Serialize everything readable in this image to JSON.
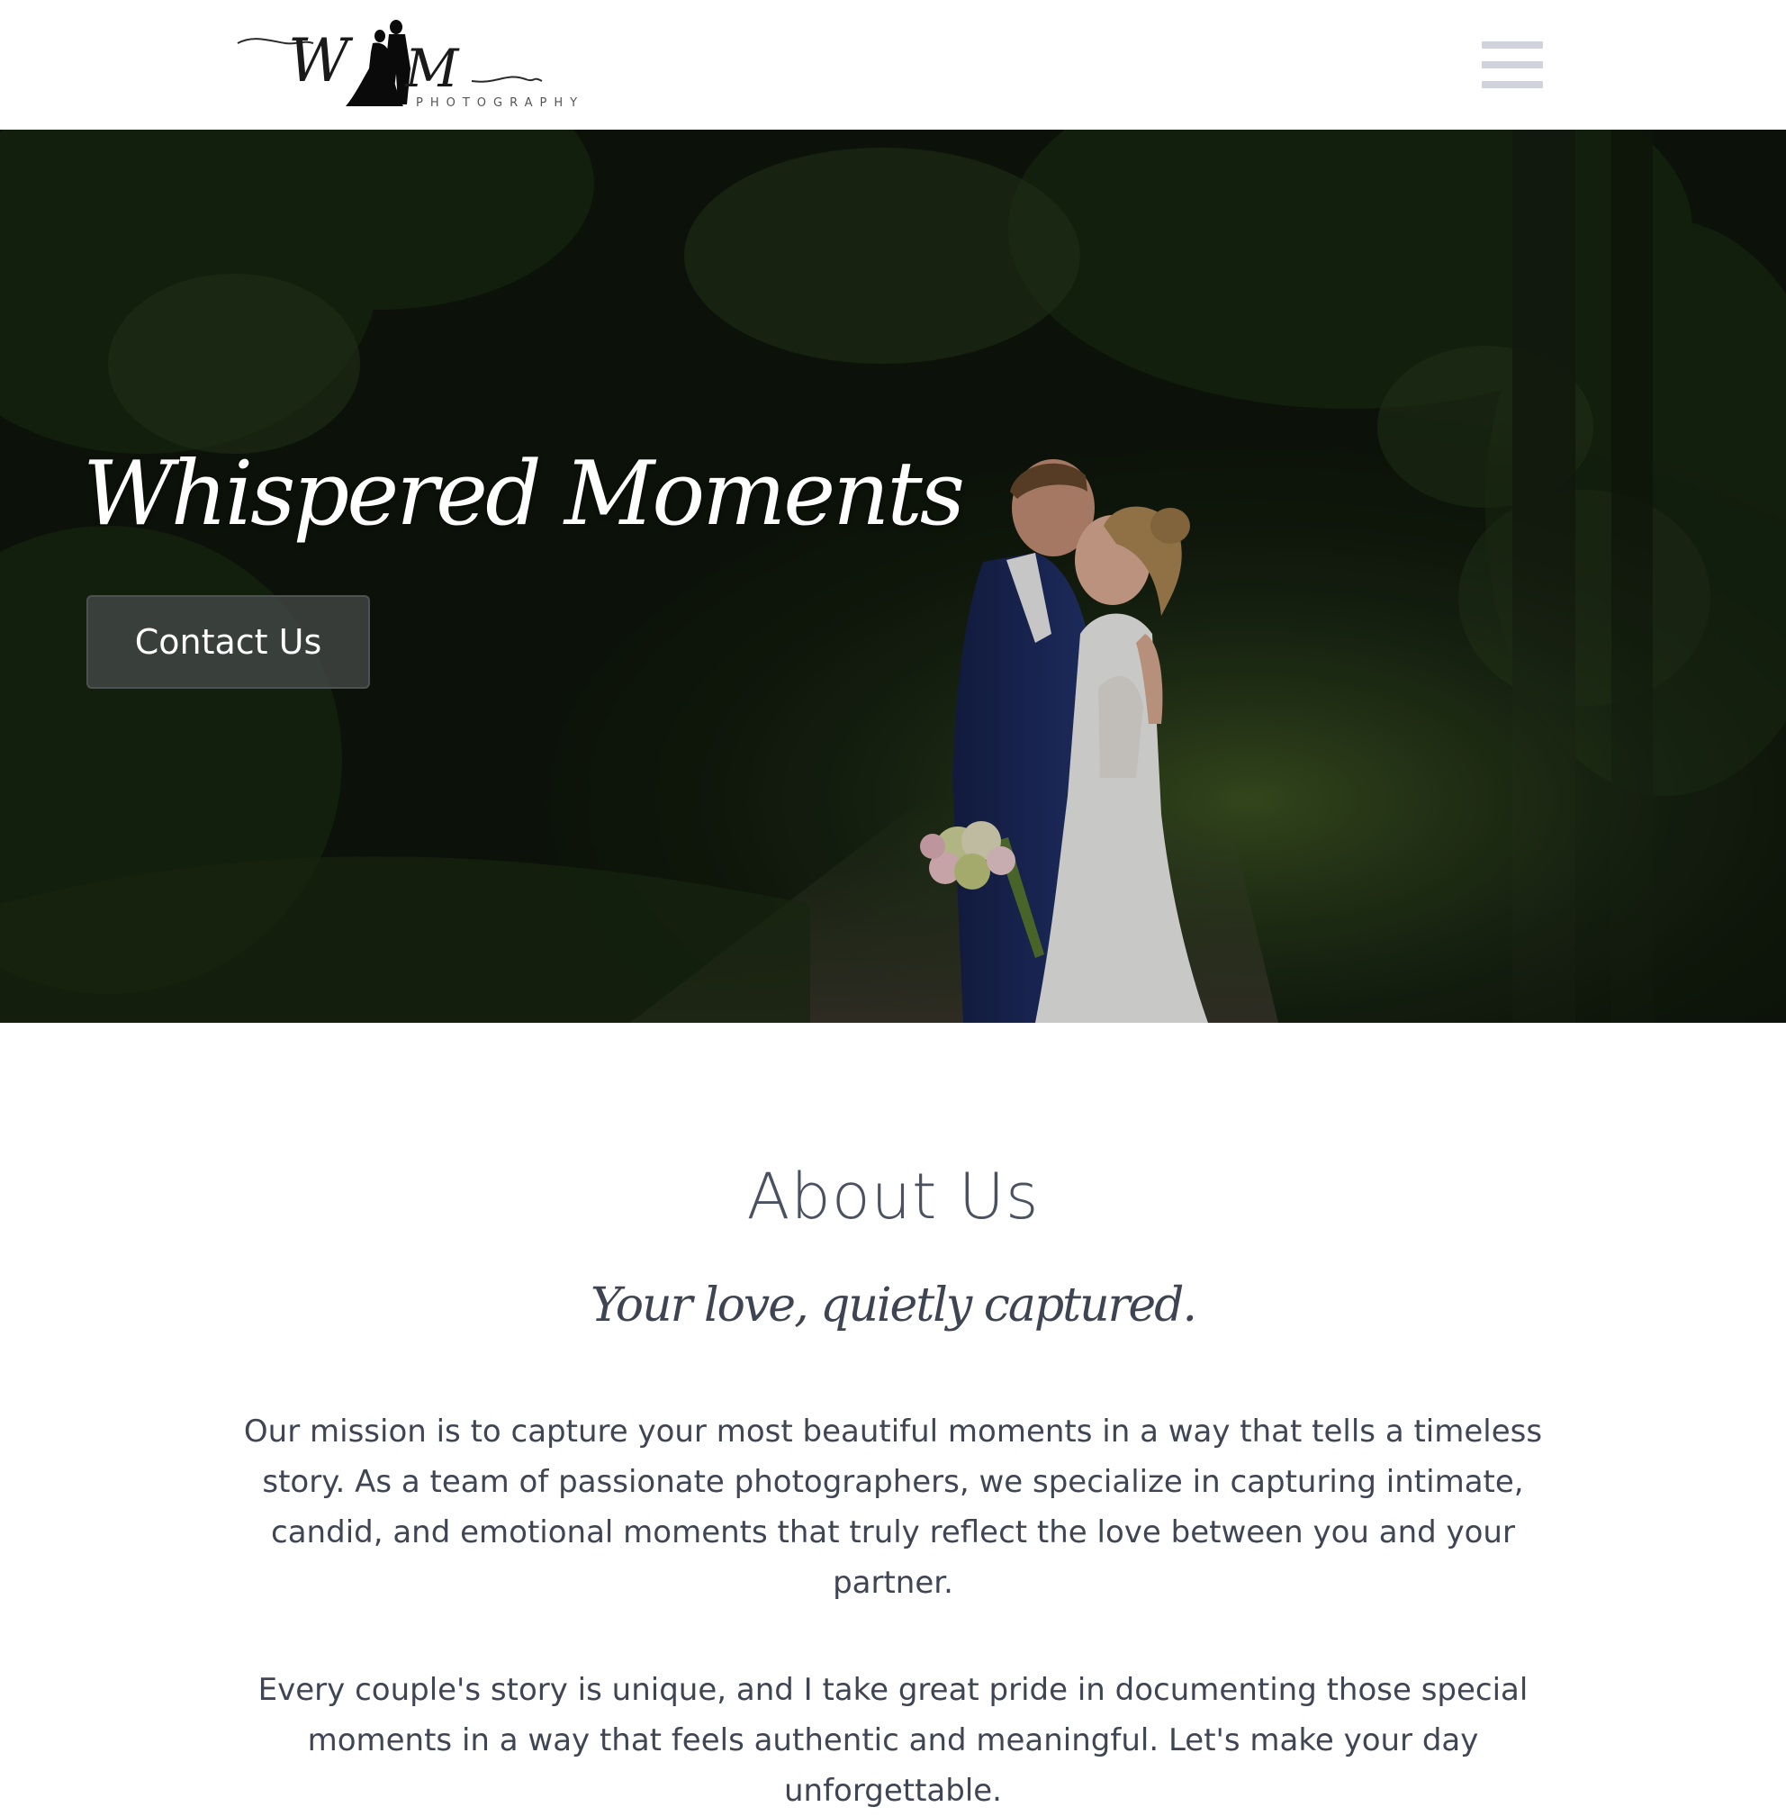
{
  "header": {
    "logo_monogram_left": "W",
    "logo_monogram_right": "M",
    "logo_subtitle": "PHOTOGRAPHY",
    "menu_icon": "hamburger-menu-icon"
  },
  "hero": {
    "title": "Whispered Moments",
    "contact_button_label": "Contact Us"
  },
  "about": {
    "heading": "About Us",
    "tagline": "Your love, quietly captured.",
    "paragraphs": [
      "Our mission is to capture your most beautiful moments in a way that tells a timeless story. As a team of passionate photographers, we specialize in capturing intimate, candid, and emotional moments that truly reflect the love between you and your partner.",
      "Every couple's story is unique, and I take great pride in documenting those special moments in a way that feels authentic and meaningful. Let's make your day unforgettable."
    ]
  },
  "colors": {
    "header_bg": "#ffffff",
    "menu_icon": "#d1d3dc",
    "hero_text": "#ffffff",
    "button_bg": "#484c4c",
    "heading_text": "#4a5160",
    "body_text": "#3f4553"
  }
}
